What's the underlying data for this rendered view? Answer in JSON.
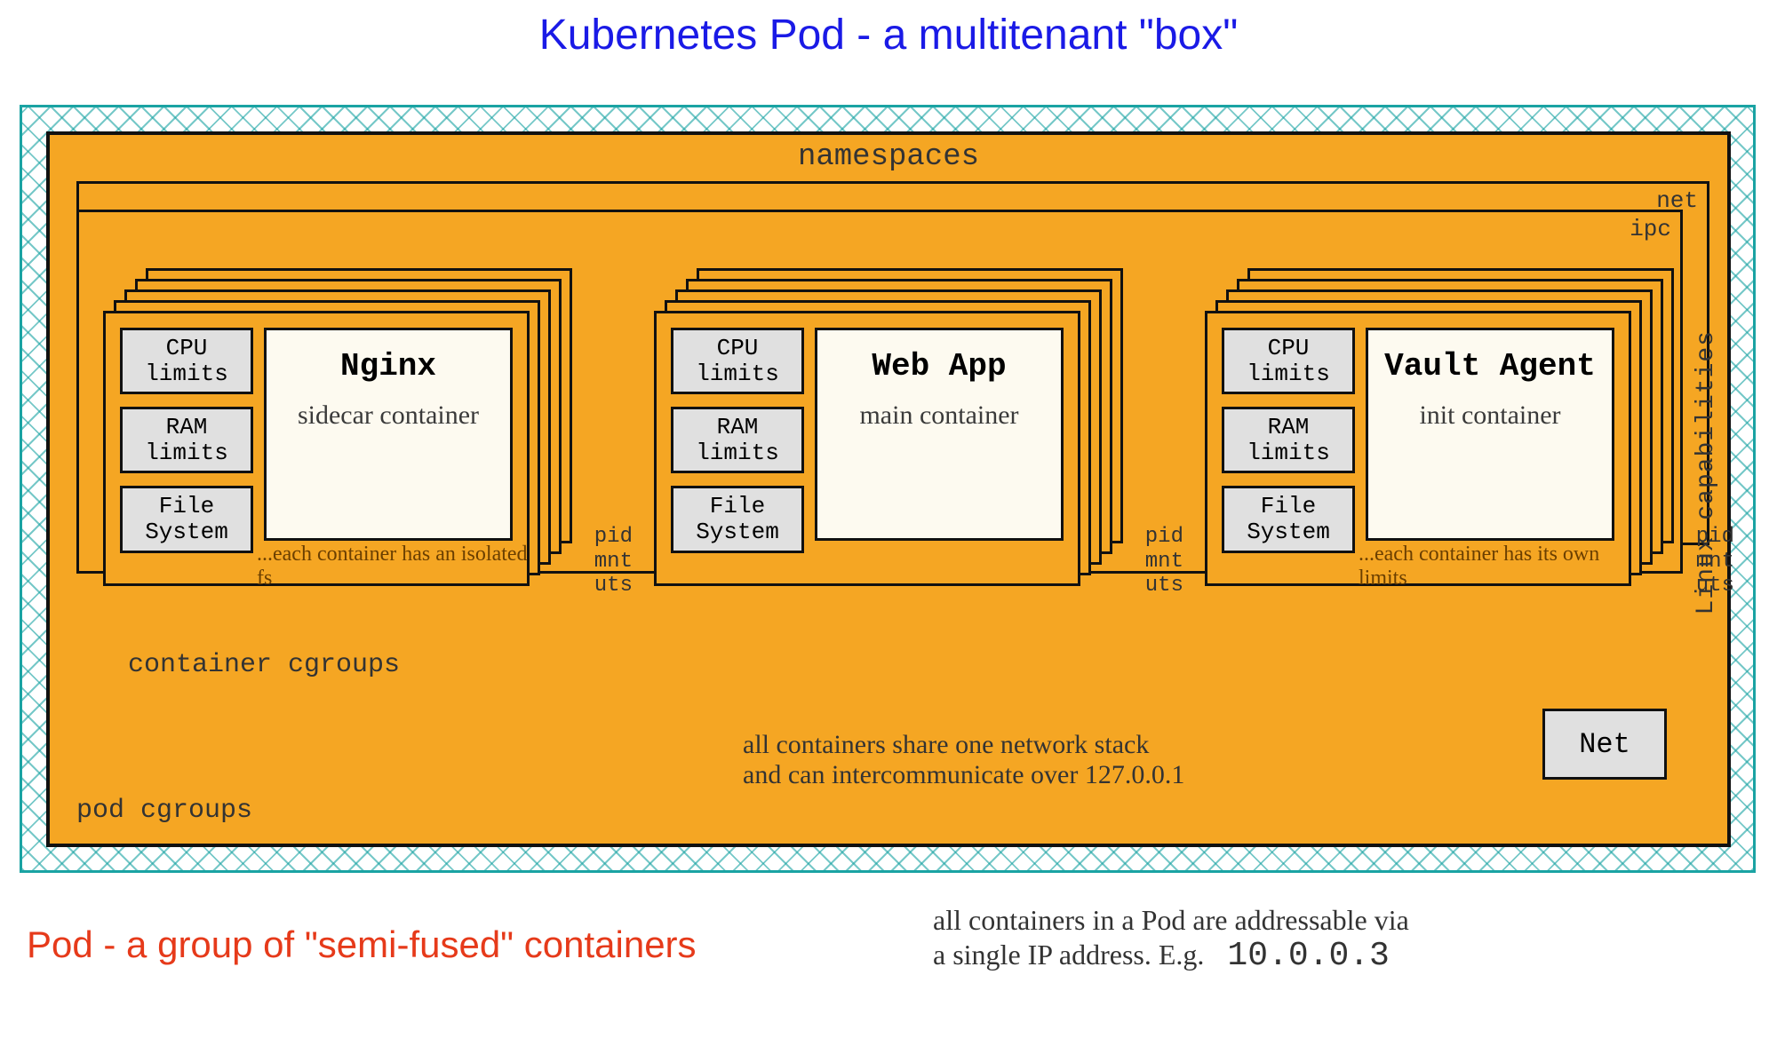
{
  "title": "Kubernetes Pod - a multitenant \"box\"",
  "pod": {
    "namespaces_label": "namespaces",
    "shared_ns": [
      "net",
      "ipc"
    ],
    "per_container_ns": [
      "pid",
      "mnt",
      "uts"
    ],
    "cgroups_under": "container cgroups",
    "pod_cgroups": "pod cgroups",
    "linux_caps": "Linux capabilities",
    "net_box": "Net",
    "share_note_l1": "all containers share one network stack",
    "share_note_l2": "and can intercommunicate over 127.0.0.1"
  },
  "containers": [
    {
      "name": "Nginx",
      "role": "sidecar container",
      "limits": [
        "CPU limits",
        "RAM limits",
        "File System"
      ],
      "under": "...each container has an isolated fs"
    },
    {
      "name": "Web App",
      "role": "main container",
      "limits": [
        "CPU limits",
        "RAM limits",
        "File System"
      ],
      "under": ""
    },
    {
      "name": "Vault Agent",
      "role": "init container",
      "limits": [
        "CPU limits",
        "RAM limits",
        "File System"
      ],
      "under": "...each container has its own limits"
    }
  ],
  "footer": {
    "left": "Pod - a group of \"semi-fused\" containers",
    "right_l1": "all containers in a Pod are addressable via",
    "right_l2": "a single IP address. E.g.",
    "ip": "10.0.0.3"
  }
}
